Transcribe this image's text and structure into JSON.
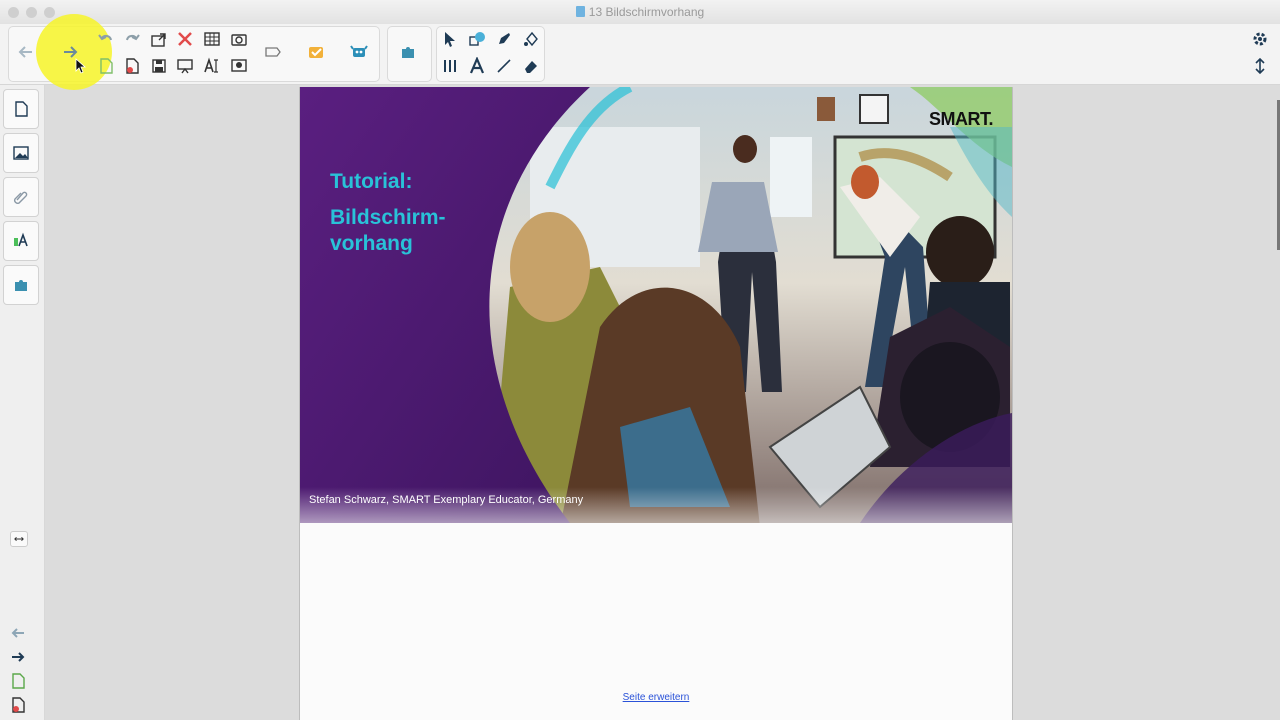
{
  "window": {
    "title": "13 Bildschirmvorhang"
  },
  "toolbar": {
    "nav": [
      "previous-page",
      "next-page"
    ],
    "edit_icons": [
      "undo",
      "redo",
      "open",
      "delete",
      "table",
      "screen-capture",
      "add-page",
      "save",
      "display-screens",
      "text-recognition",
      "capture-area"
    ],
    "extra_icons": [
      "tag",
      "response",
      "add-ons",
      "lab"
    ],
    "tools": [
      "select",
      "shapes",
      "pens",
      "fill",
      "measure",
      "text",
      "lines",
      "eraser"
    ]
  },
  "sidebar": {
    "tabs": [
      "page-sorter",
      "gallery",
      "attachments",
      "properties",
      "add-ons"
    ]
  },
  "slide": {
    "title": "Tutorial:",
    "subtitle": "Bildschirm-\nvorhang",
    "author": "Stefan Schwarz, SMART Exemplary Educator, Germany",
    "logo": "SMART."
  },
  "page": {
    "extend_link": "Seite erweitern"
  },
  "colors": {
    "purple": "#4b1b6e",
    "accent": "#29c2d8",
    "highlight": "#f7f528"
  }
}
